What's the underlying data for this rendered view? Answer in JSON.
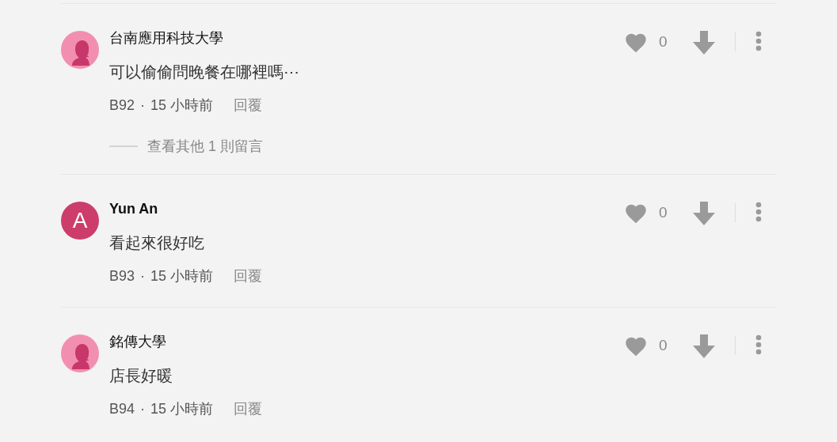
{
  "comments": [
    {
      "avatar": {
        "kind": "silhouette"
      },
      "author": "台南應用科技大學",
      "author_bold": false,
      "body": "可以偷偷問晚餐在哪裡嗎⋯",
      "floor": "B92",
      "separator": "·",
      "time": "15 小時前",
      "reply": "回覆",
      "likes": "0",
      "more_replies": "查看其他 1 則留言"
    },
    {
      "avatar": {
        "kind": "letter",
        "letter": "A",
        "color": "#cc3d6c"
      },
      "author": "Yun An",
      "author_bold": true,
      "body": "看起來很好吃",
      "floor": "B93",
      "separator": "·",
      "time": "15 小時前",
      "reply": "回覆",
      "likes": "0"
    },
    {
      "avatar": {
        "kind": "silhouette"
      },
      "author": "銘傳大學",
      "author_bold": false,
      "body": "店長好暖",
      "floor": "B94",
      "separator": "·",
      "time": "15 小時前",
      "reply": "回覆",
      "likes": "0"
    }
  ]
}
